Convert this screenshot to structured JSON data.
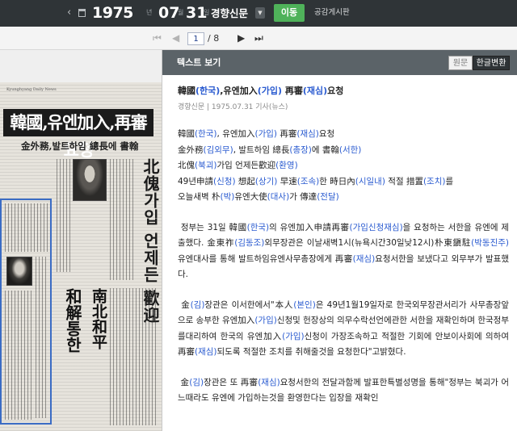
{
  "topbar": {
    "prev": "‹",
    "next": "›",
    "year": "1975",
    "year_unit": "년",
    "month": "07",
    "month_unit": "월",
    "day": "31",
    "day_unit": "일",
    "newspaper": "경향신문",
    "go_label": "이동",
    "board_label": "공감게시판"
  },
  "pager": {
    "current_page": "1",
    "total": "/ 8"
  },
  "newspaper_image": {
    "masthead": "Kyunghyang Daily News",
    "headline_main": "韓國,유엔加入,再審요청",
    "headline_sub": "金外務,발트하임 總長에 書翰",
    "headline_vertical": "北傀가입 언제든 歡迎",
    "headline_bottom_1": "和解통한",
    "headline_bottom_2": "南北和平"
  },
  "panel": {
    "title": "텍스트 보기",
    "toggle_original": "원문",
    "toggle_converted": "한글변환"
  },
  "article": {
    "title_a": "韓國",
    "title_b": "(한국)",
    "title_c": ",유엔加入",
    "title_d": "(가입)",
    "title_e": " 再審",
    "title_f": "(재심)",
    "title_g": "요청",
    "meta": "경향신문 | 1975.07.31 기사(뉴스)",
    "lead_1a": "韓國",
    "lead_1b": "(한국)",
    "lead_1c": ", 유엔加入",
    "lead_1d": "(가입)",
    "lead_1e": " 再審",
    "lead_1f": "(재심)",
    "lead_1g": "요청",
    "lead_2a": "金外務",
    "lead_2b": "(김외무)",
    "lead_2c": ", 발트하임 總長",
    "lead_2d": "(총장)",
    "lead_2e": "에 書翰",
    "lead_2f": "(서한)",
    "lead_3a": "北傀",
    "lead_3b": "(북괴)",
    "lead_3c": "가입 언제든歡迎",
    "lead_3d": "(환영)",
    "lead_4a": "49년申請",
    "lead_4b": "(신청)",
    "lead_4c": " 想起",
    "lead_4d": "(상기)",
    "lead_4e": " 早速",
    "lead_4f": "(조속)",
    "lead_4g": "한 時日內",
    "lead_4h": "(시일내)",
    "lead_4i": " 적절 措置",
    "lead_4j": "(조치)",
    "lead_4k": "를",
    "lead_5a": "오늘새벽 朴",
    "lead_5b": "(박)",
    "lead_5c": "유엔大使",
    "lead_5d": "(대사)",
    "lead_5e": "가 傳達",
    "lead_5f": "(전달)",
    "p1_a": "정부는 31일 韓國",
    "p1_b": "(한국)",
    "p1_c": "의 유엔加入申請再審",
    "p1_d": "(가입신청재심)",
    "p1_e": "을 요청하는 서한을 유엔에 제출했다. 金東祚",
    "p1_f": "(김동조)",
    "p1_g": "외무장관은 이날새벽1시(뉴욕시간30일낮12시)朴東鎭駐",
    "p1_h": "(박동진주)",
    "p1_i": "유엔대사를 통해 발트하임유엔사무총장에게 再審",
    "p1_j": "(재심)",
    "p1_k": "요청서한을 보냈다고 외무부가 발표했다.",
    "p2_a": "金",
    "p2_b": "(김)",
    "p2_c": "장관은 이서한에서\"本人",
    "p2_d": "(본인)",
    "p2_e": "은 49년1월19일자로 한국외무장관서리가 사무총장앞으로 송부한 유엔加入",
    "p2_f": "(가입)",
    "p2_g": "신청및 헌장상의 의무수락선언에관한 서한을 재확인하며 한국정부를대리하여 한국의 유엔加入",
    "p2_h": "(가입)",
    "p2_i": "신청이 가장조속하고 적절한 기회에 안보이사회에 의하여 再審",
    "p2_j": "(재심)",
    "p2_k": "되도록 적절한 조치를 취해줄것을 요청한다\"고밝혔다.",
    "p3_a": "金",
    "p3_b": "(김)",
    "p3_c": "장관은 또 再審",
    "p3_d": "(재심)",
    "p3_e": "요청서한의 전달과함께 발표한특별성명을 통해\"정부는 북괴가 어느때라도 유엔에 가입하는것을 환영한다는 입장을 재확인"
  }
}
